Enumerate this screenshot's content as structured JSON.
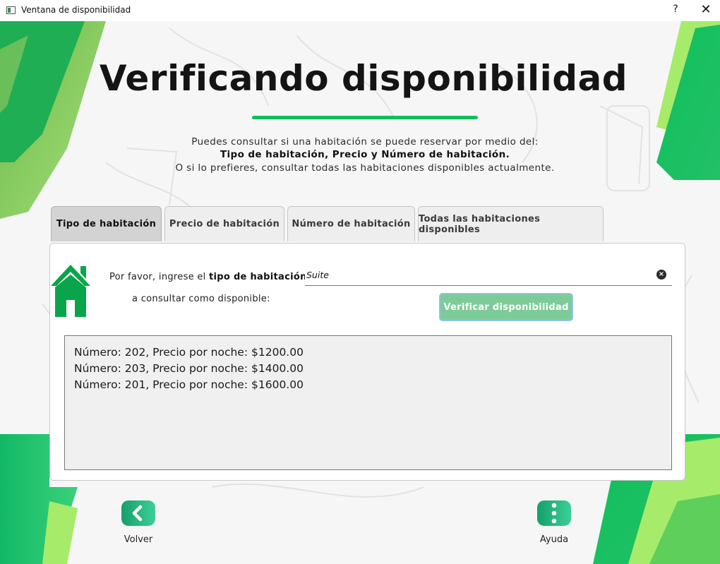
{
  "window": {
    "title": "Ventana de disponibilidad",
    "help_glyph": "?",
    "close_glyph": "✕"
  },
  "header": {
    "title": "Verificando disponibilidad",
    "intro_line1": "Puedes consultar si una habitación se puede reservar por medio del:",
    "intro_line2": "Tipo de habitación, Precio y Número de habitación.",
    "intro_line3": "O si lo prefieres, consultar todas las habitaciones disponibles actualmente."
  },
  "tabs": [
    {
      "label": "Tipo de habitación",
      "active": true
    },
    {
      "label": "Precio de habitación",
      "active": false
    },
    {
      "label": "Número de habitación",
      "active": false
    },
    {
      "label": "Todas las habitaciones disponibles",
      "active": false
    }
  ],
  "form": {
    "prompt_prefix": "Por favor, ingrese el ",
    "prompt_bold": "tipo de habitación",
    "prompt_line2": "a consultar como disponible:",
    "input_value": "Suite",
    "verify_label": "Verificar disponibilidad",
    "house_icon": "house-icon",
    "clear_icon": "clear-icon"
  },
  "results": [
    "Número: 202, Precio por noche: $1200.00",
    "Número: 203, Precio por noche: $1400.00",
    "Número: 201, Precio por noche: $1600.00"
  ],
  "nav": {
    "back_label": "Volver",
    "help_label": "Ayuda",
    "back_icon": "chevron-left-icon",
    "help_icon": "more-vertical-icon"
  },
  "colors": {
    "accent_green": "#0fbf5a",
    "house_green": "#0aa54a",
    "button_green": "#7ecb9a"
  }
}
